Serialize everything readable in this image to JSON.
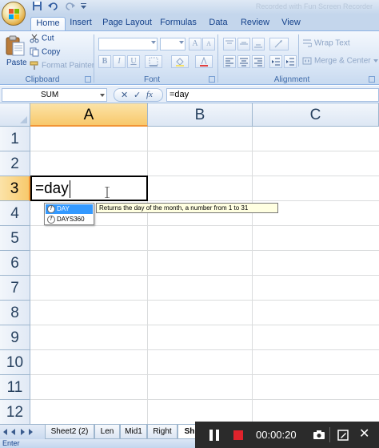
{
  "titlebar": {
    "title": "Recorded with Fun Screen Recorder"
  },
  "ribbon_tabs": [
    "Home",
    "Insert",
    "Page Layout",
    "Formulas",
    "Data",
    "Review",
    "View"
  ],
  "clipboard": {
    "paste_label": "Paste",
    "cut_label": "Cut",
    "copy_label": "Copy",
    "format_painter_label": "Format Painter",
    "group_label": "Clipboard"
  },
  "font": {
    "group_label": "Font",
    "bold": "B",
    "italic": "I",
    "underline": "U"
  },
  "alignment": {
    "wrap_text_label": "Wrap Text",
    "merge_center_label": "Merge & Center",
    "group_label": "Alignment"
  },
  "formula_bar": {
    "name_box": "SUM",
    "cancel": "✕",
    "enter": "✓",
    "fx": "fx",
    "formula": "=day"
  },
  "grid": {
    "columns": [
      "A",
      "B",
      "C"
    ],
    "rows": [
      "1",
      "2",
      "3",
      "4",
      "5",
      "6",
      "7",
      "8",
      "9",
      "10",
      "11",
      "12"
    ],
    "active_cell_text": "=day"
  },
  "autocomplete": {
    "items": [
      "DAY",
      "DAYS360"
    ],
    "selected": "DAY",
    "tooltip": "Returns the day of the month, a number from 1 to 31"
  },
  "sheet_tabs": [
    "Sheet2 (2)",
    "Len",
    "Mid1",
    "Right",
    "Sh"
  ],
  "active_sheet": "Sh",
  "status": {
    "mode": "Enter"
  },
  "recorder": {
    "time": "00:00:20",
    "close": "✕"
  },
  "colors": {
    "ribbon": "#dbe7f6",
    "selected_header": "#f8c96c",
    "autocomplete_selected": "#3399ff",
    "tooltip_bg": "#ffffe1",
    "record_stop": "#e0232c"
  }
}
